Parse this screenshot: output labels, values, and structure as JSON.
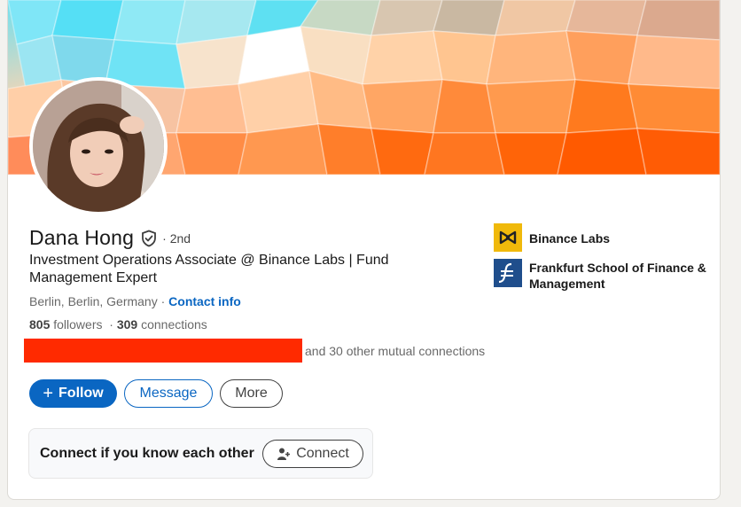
{
  "profile": {
    "name": "Dana Hong",
    "degree": "· 2nd",
    "headline": "Investment Operations Associate @ Binance Labs | Fund Management Expert",
    "location": "Berlin, Berlin, Germany ·",
    "contact_info": "Contact info",
    "followers_count": "805",
    "followers_label": "followers",
    "connections_count": "309",
    "connections_label": "connections",
    "mutual_text": "and 30 other mutual connections"
  },
  "actions": {
    "follow": "Follow",
    "message": "Message",
    "more": "More"
  },
  "connect_prompt": {
    "text": "Connect if you know each other",
    "button": "Connect"
  },
  "organizations": [
    {
      "name": "Binance Labs",
      "logo": "binance-labs-logo",
      "color": "#f0b90b"
    },
    {
      "name": "Frankfurt School of Finance & Management",
      "logo": "frankfurt-school-logo",
      "color": "#1f4e8c"
    }
  ],
  "colors": {
    "primary": "#0a66c2",
    "redaction": "#ff2a00"
  }
}
